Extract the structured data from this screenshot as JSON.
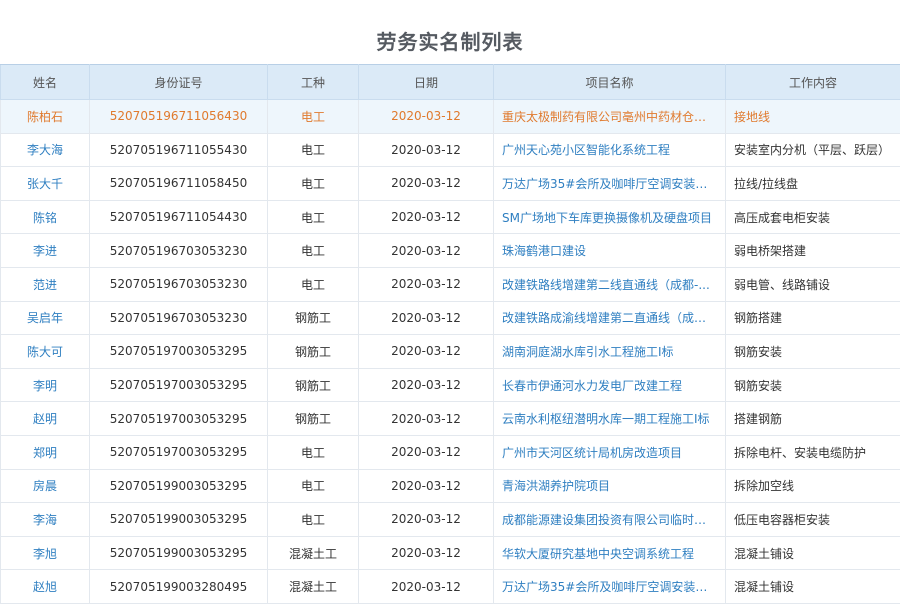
{
  "page": {
    "title": "劳务实名制列表"
  },
  "table": {
    "headers": [
      "姓名",
      "身份证号",
      "工种",
      "日期",
      "项目名称",
      "工作内容"
    ],
    "rows": [
      [
        "陈柏石",
        "520705196711056430",
        "电工",
        "2020-03-12",
        "重庆太极制药有限公司亳州中药材仓储...",
        "接地线"
      ],
      [
        "李大海",
        "520705196711055430",
        "电工",
        "2020-03-12",
        "广州天心苑小区智能化系统工程",
        "安装室内分机（平层、跃层）"
      ],
      [
        "张大千",
        "520705196711058450",
        "电工",
        "2020-03-12",
        "万达广场35#会所及咖啡厅空调安装工程",
        "拉线/拉线盘"
      ],
      [
        "陈铭",
        "520705196711054430",
        "电工",
        "2020-03-12",
        "SM广场地下车库更换摄像机及硬盘项目",
        "高压成套电柜安装"
      ],
      [
        "李进",
        "520705196703053230",
        "电工",
        "2020-03-12",
        "珠海鹤港口建设",
        "弱电桥架搭建"
      ],
      [
        "范进",
        "520705196703053230",
        "电工",
        "2020-03-12",
        "改建铁路线增建第二线直通线（成都-...",
        "弱电管、线路铺设"
      ],
      [
        "吴启年",
        "520705196703053230",
        "钢筋工",
        "2020-03-12",
        "改建铁路成渝线增建第二直通线（成渝...",
        "钢筋搭建"
      ],
      [
        "陈大可",
        "520705197003053295",
        "钢筋工",
        "2020-03-12",
        "湖南洞庭湖水库引水工程施工I标",
        "钢筋安装"
      ],
      [
        "李明",
        "520705197003053295",
        "钢筋工",
        "2020-03-12",
        "长春市伊通河水力发电厂改建工程",
        "钢筋安装"
      ],
      [
        "赵明",
        "520705197003053295",
        "钢筋工",
        "2020-03-12",
        "云南水利枢纽潜明水库一期工程施工I标",
        "搭建钢筋"
      ],
      [
        "郑明",
        "520705197003053295",
        "电工",
        "2020-03-12",
        "广州市天河区统计局机房改造项目",
        "拆除电杆、安装电缆防护"
      ],
      [
        "房晨",
        "520705199003053295",
        "电工",
        "2020-03-12",
        "青海洪湖养护院项目",
        "拆除加空线"
      ],
      [
        "李海",
        "520705199003053295",
        "电工",
        "2020-03-12",
        "成都能源建设集团投资有限公司临时办...",
        "低压电容器柜安装"
      ],
      [
        "李旭",
        "520705199003053295",
        "混凝土工",
        "2020-03-12",
        "华软大厦研究基地中央空调系统工程",
        "混凝土铺设"
      ],
      [
        "赵旭",
        "520705199003280495",
        "混凝土工",
        "2020-03-12",
        "万达广场35#会所及咖啡厅空调安装工程",
        "混凝土铺设"
      ]
    ],
    "selected_row": 0
  },
  "colors": {
    "header_bg": "#dbeaf7",
    "link": "#2f7fc1",
    "selected_text": "#e07a2e",
    "selected_bg": "#eef6fc"
  }
}
